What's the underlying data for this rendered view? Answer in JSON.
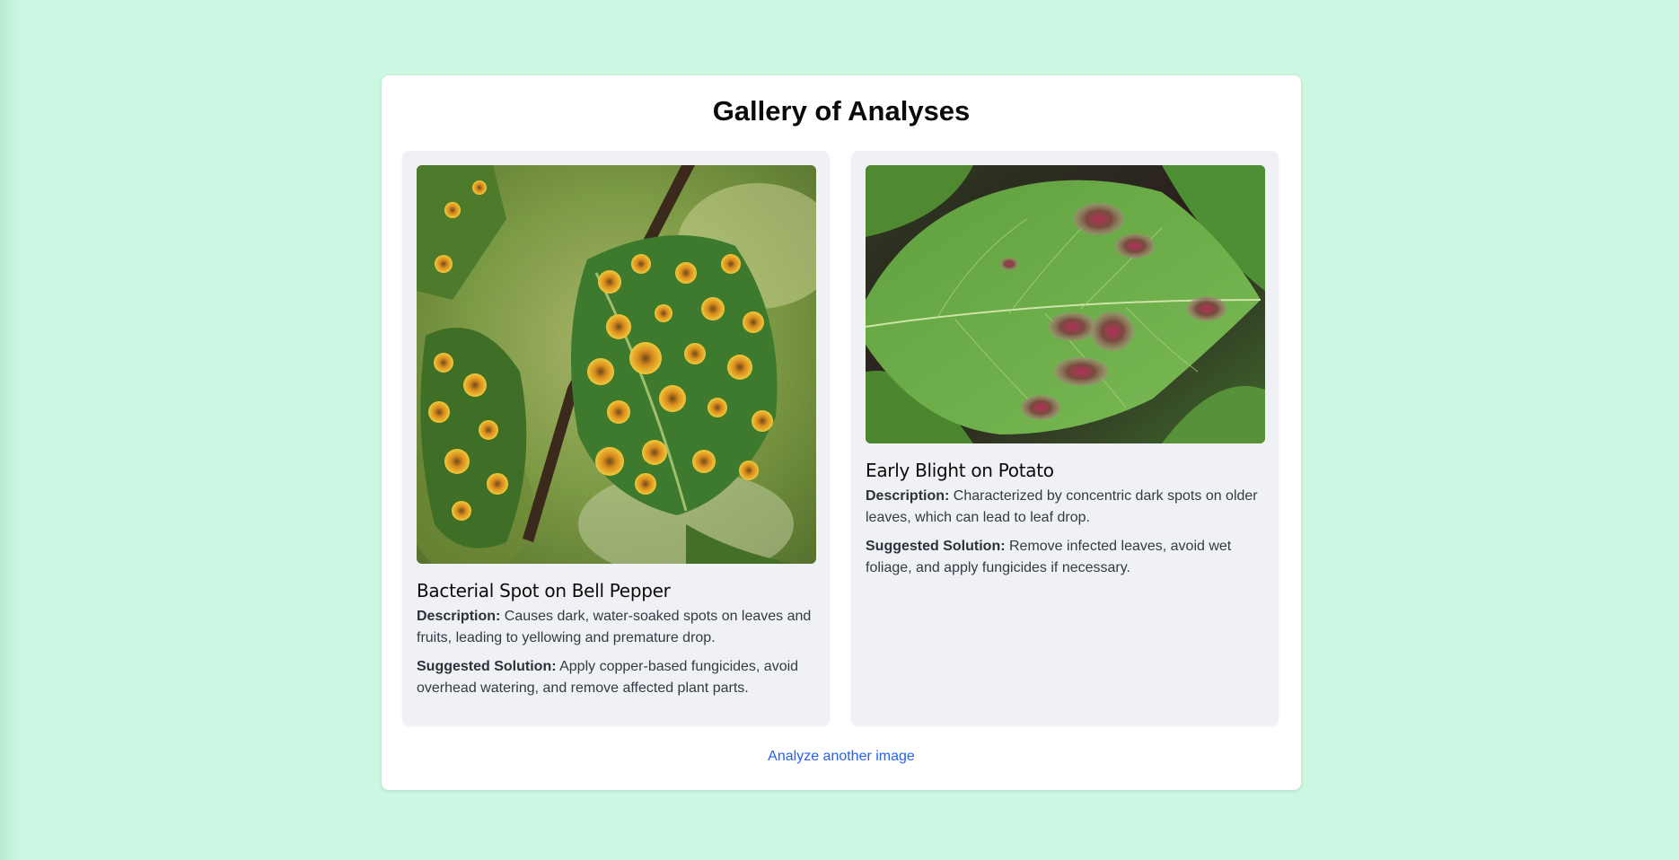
{
  "page": {
    "title": "Gallery of Analyses",
    "background_color": "#ccf7e2"
  },
  "cards": [
    {
      "title": "Bacterial Spot on Bell Pepper",
      "image_subject": "leaf-with-orange-rust-spots",
      "description_label": "Description:",
      "description": "Causes dark, water-soaked spots on leaves and fruits, leading to yellowing and premature drop.",
      "solution_label": "Suggested Solution:",
      "solution": "Apply copper-based fungicides, avoid overhead watering, and remove affected plant parts."
    },
    {
      "title": "Early Blight on Potato",
      "image_subject": "leaf-with-brown-blight-lesions",
      "description_label": "Description:",
      "description": "Characterized by concentric dark spots on older leaves, which can lead to leaf drop.",
      "solution_label": "Suggested Solution:",
      "solution": "Remove infected leaves, avoid wet foliage, and apply fungicides if necessary."
    }
  ],
  "footer": {
    "link_label": "Analyze another image",
    "link_color": "#2563eb"
  }
}
